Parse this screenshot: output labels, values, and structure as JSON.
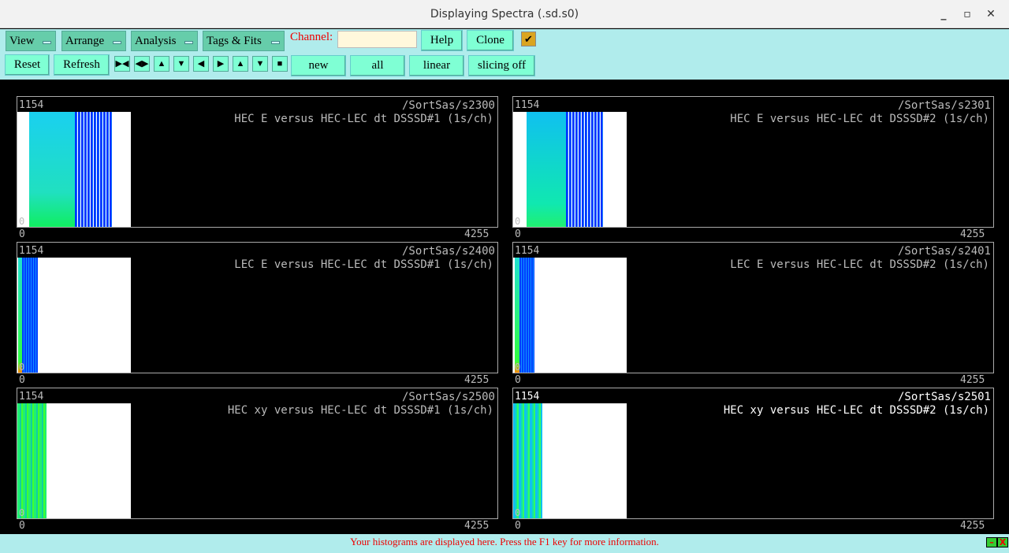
{
  "window": {
    "title": "Displaying Spectra (.sd.s0)",
    "minimize": "_",
    "maximize": "▫",
    "close": "✕"
  },
  "menus": [
    "View",
    "Arrange",
    "Analysis",
    "Tags & Fits"
  ],
  "channel": {
    "label": "Channel:",
    "value": ""
  },
  "buttons": {
    "help": "Help",
    "clone": "Clone",
    "reset": "Reset",
    "refresh": "Refresh",
    "new": "new",
    "all": "all",
    "linear": "linear",
    "slicing": "slicing off"
  },
  "checkbox": {
    "checked": true,
    "mark": "✔"
  },
  "nav_icons": [
    {
      "name": "expand-horizontal-icon",
      "glyph": "▶◀"
    },
    {
      "name": "shrink-horizontal-icon",
      "glyph": "◀▶"
    },
    {
      "name": "expand-vertical-icon",
      "glyph": "▲"
    },
    {
      "name": "shrink-vertical-icon",
      "glyph": "▼"
    },
    {
      "name": "scroll-left-icon",
      "glyph": "◀"
    },
    {
      "name": "scroll-right-icon",
      "glyph": "▶"
    },
    {
      "name": "scroll-up-icon",
      "glyph": "▲"
    },
    {
      "name": "scroll-down-icon",
      "glyph": "▼"
    },
    {
      "name": "full-view-icon",
      "glyph": "■"
    }
  ],
  "panels": [
    {
      "path": "/SortSas/s2300",
      "title": "HEC E versus HEC-LEC dt DSSSD#1 (1s/ch)",
      "ymax": "1154",
      "ymin": "0",
      "xmin": "0",
      "xmax": "4255",
      "selected": false
    },
    {
      "path": "/SortSas/s2301",
      "title": "HEC E versus HEC-LEC dt DSSSD#2 (1s/ch)",
      "ymax": "1154",
      "ymin": "0",
      "xmin": "0",
      "xmax": "4255",
      "selected": false
    },
    {
      "path": "/SortSas/s2400",
      "title": "LEC E versus HEC-LEC dt DSSSD#1 (1s/ch)",
      "ymax": "1154",
      "ymin": "0",
      "xmin": "0",
      "xmax": "4255",
      "selected": false
    },
    {
      "path": "/SortSas/s2401",
      "title": "LEC E versus HEC-LEC dt DSSSD#2 (1s/ch)",
      "ymax": "1154",
      "ymin": "0",
      "xmin": "0",
      "xmax": "4255",
      "selected": false
    },
    {
      "path": "/SortSas/s2500",
      "title": "HEC xy versus HEC-LEC dt DSSSD#1 (1s/ch)",
      "ymax": "1154",
      "ymin": "0",
      "xmin": "0",
      "xmax": "4255",
      "selected": false
    },
    {
      "path": "/SortSas/s2501",
      "title": "HEC xy versus HEC-LEC dt DSSSD#2 (1s/ch)",
      "ymax": "1154",
      "ymin": "0",
      "xmin": "0",
      "xmax": "4255",
      "selected": true
    }
  ],
  "status": {
    "message": "Your histograms are displayed here. Press the F1 key for more information.",
    "min": "–",
    "close": "X"
  }
}
